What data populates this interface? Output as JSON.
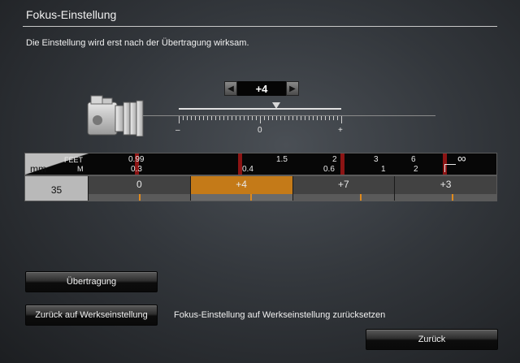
{
  "window": {
    "title": "Fokus-Einstellung"
  },
  "subtitle": "Die Einstellung wird erst nach der Übertragung wirksam.",
  "icons": {
    "camera": "camera-icon",
    "prev": "arrow-left-icon",
    "next": "arrow-right-icon",
    "infinity": "infinity-icon"
  },
  "stepper": {
    "value": "+4"
  },
  "slider": {
    "min_label": "–",
    "mid_label": "0",
    "max_label": "+",
    "value": 4,
    "range": [
      -20,
      20
    ]
  },
  "scale": {
    "unit_mm": "mm",
    "unit_feet": "FEET",
    "unit_m": "M",
    "feet_labels": [
      "0.99",
      "1.5",
      "2",
      "3",
      "6"
    ],
    "m_labels": [
      "0.3",
      "0.4",
      "0.6",
      "1",
      "2"
    ],
    "infinity": "∞"
  },
  "lens": {
    "focal_length": "35",
    "cells": [
      "0",
      "+4",
      "+7",
      "+3"
    ],
    "active_index": 1
  },
  "buttons": {
    "transfer": "Übertragung",
    "reset": "Zurück auf Werkseinstellung",
    "back": "Zurück"
  },
  "reset_description": "Fokus-Einstellung auf Werkseinstellung zurücksetzen",
  "colors": {
    "accent": "#c47a18",
    "marker": "#8c1414",
    "pin": "#e08a1c"
  }
}
